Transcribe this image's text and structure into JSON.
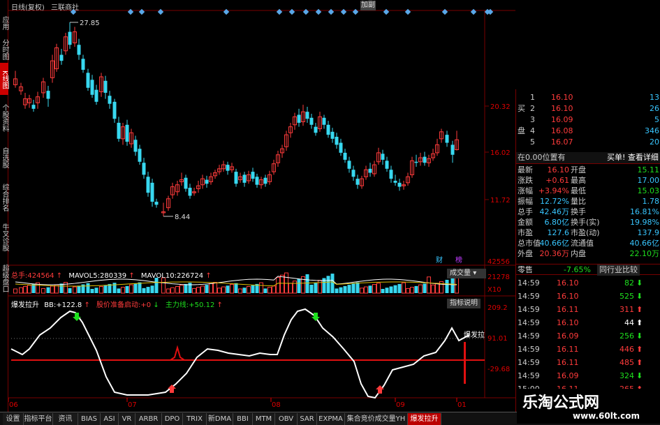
{
  "header": {
    "title": "日线(复权)",
    "stock": "三联商社",
    "corner_btn": "加副"
  },
  "left_tabs": [
    "应用",
    "分时图",
    "K线图",
    "个股资料",
    "自选股",
    "综合排名",
    "牛叉诊股",
    "超级盘口"
  ],
  "main_chart": {
    "high_label": "27.85",
    "low_label": "8.44",
    "axis_ticks": [
      "20.32",
      "16.02",
      "11.72"
    ],
    "fin_badge": "财",
    "event_badge": "榜"
  },
  "volume_panel": {
    "label_total": "总手:",
    "total": "424564",
    "label_ma5": "MAVOL5:",
    "ma5": "280339",
    "label_ma10": "MAVOL10:",
    "ma10": "226724",
    "button": "成交量",
    "ticks": [
      "42556",
      "21278",
      "X10"
    ]
  },
  "indicator_panel": {
    "name": "爆发拉升",
    "bb_label": "BB:",
    "bb": "+122.8",
    "ready_label": "股价准备启动:",
    "ready": "+0",
    "main_label": "主力线:",
    "main": "+50.12",
    "button": "指标说明",
    "tag": "爆发拉",
    "ticks": [
      "209.2",
      "91.01",
      "-29.68"
    ]
  },
  "x_axis": [
    "06",
    "07",
    "08",
    "09",
    "01"
  ],
  "quote": {
    "bid_side_labels": [
      "买",
      "盘"
    ],
    "bids": [
      {
        "n": "1",
        "price": "16.10",
        "vol": "13"
      },
      {
        "n": "2",
        "price": "16.10",
        "vol": "26"
      },
      {
        "n": "3",
        "price": "16.09",
        "vol": "5"
      },
      {
        "n": "4",
        "price": "16.08",
        "vol": "346"
      },
      {
        "n": "5",
        "price": "16.07",
        "vol": "20"
      }
    ],
    "position_text": "在0.00位置有",
    "buy_link": "买单! 查看详细",
    "stats": [
      {
        "l1": "最新",
        "v1": "16.10",
        "l2": "开盘",
        "v2": "15.11"
      },
      {
        "l1": "涨跌",
        "v1": "+0.61",
        "l2": "最高",
        "v2": "17.00"
      },
      {
        "l1": "涨幅",
        "v1": "+3.94%",
        "l2": "最低",
        "v2": "15.03"
      },
      {
        "l1": "振幅",
        "v1": "12.72%",
        "l2": "量比",
        "v2": "1.78"
      },
      {
        "l1": "总手",
        "v1": "42.46万",
        "l2": "换手",
        "v2": "16.81%"
      },
      {
        "l1": "金额",
        "v1": "6.80亿",
        "l2": "换手(实)",
        "v2": "19.98%"
      },
      {
        "l1": "市盈",
        "v1": "127.6",
        "l2": "市盈(动)",
        "v2": "137.9"
      },
      {
        "l1": "总市值",
        "v1": "40.66亿",
        "l2": "流通值",
        "v2": "40.66亿"
      },
      {
        "l1": "外盘",
        "v1": "20.36万",
        "l2": "内盘",
        "v2": "22.10万"
      }
    ],
    "sector_name": "零售",
    "sector_pct": "-7.65%",
    "compare_btn": "同行业比较",
    "ticks": [
      {
        "t": "14:59",
        "p": "16.10",
        "v": "82",
        "d": "down"
      },
      {
        "t": "14:59",
        "p": "16.10",
        "v": "525",
        "d": "down"
      },
      {
        "t": "14:59",
        "p": "16.11",
        "v": "311",
        "d": "up"
      },
      {
        "t": "14:59",
        "p": "16.10",
        "v": "44",
        "d": "up-white"
      },
      {
        "t": "14:59",
        "p": "16.09",
        "v": "256",
        "d": "down"
      },
      {
        "t": "14:59",
        "p": "16.11",
        "v": "446",
        "d": "up"
      },
      {
        "t": "14:59",
        "p": "16.11",
        "v": "485",
        "d": "up"
      },
      {
        "t": "14:59",
        "p": "16.09",
        "v": "324",
        "d": "down"
      },
      {
        "t": "15:00",
        "p": "16.11",
        "v": "265",
        "d": "up"
      }
    ]
  },
  "bottom_tabs": [
    "设置",
    "指标平台",
    "资讯",
    "BIAS",
    "ASI",
    "VR",
    "ARBR",
    "DPO",
    "TRIX",
    "新DMA",
    "BBI",
    "MTM",
    "OBV",
    "SAR",
    "EXPMA",
    "集合竞价成交量YH",
    "爆发拉升"
  ],
  "watermark": {
    "cn": "乐淘公式网",
    "url": "www.60lt.com"
  },
  "colors": {
    "up": "#ff3b3b",
    "down": "#1ee01e",
    "cyan": "#38d8f0",
    "frame": "#7a0000",
    "ma5": "#ffffff",
    "ma10": "#e0c000"
  }
}
